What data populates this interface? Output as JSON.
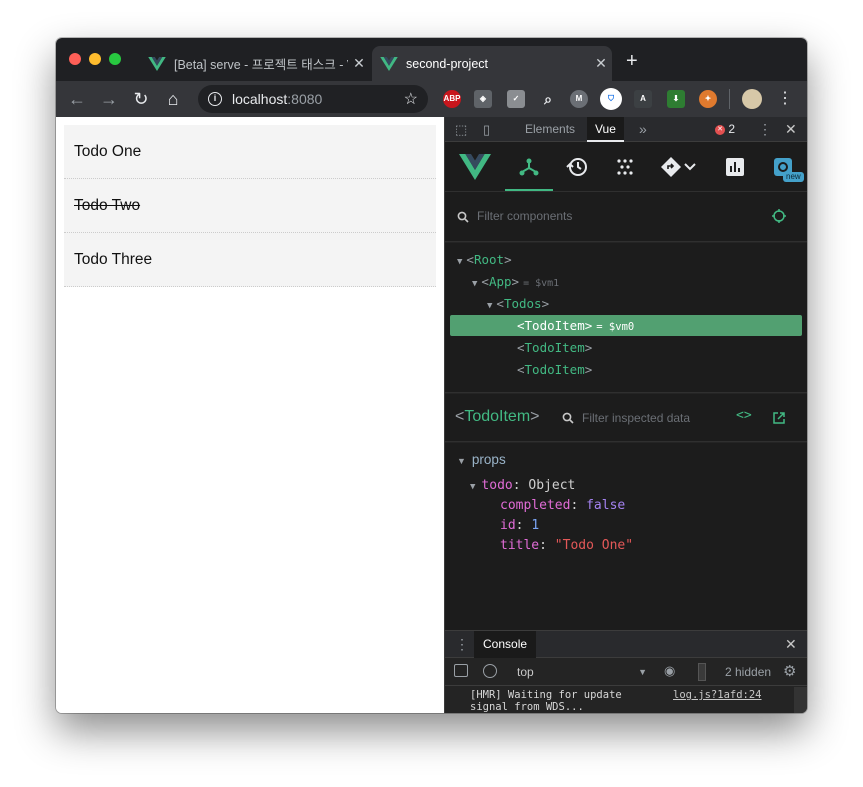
{
  "browser": {
    "tabs": [
      {
        "title": "[Beta] serve - 프로젝트 태스크 - Vu",
        "active": false
      },
      {
        "title": "second-project",
        "active": true
      }
    ],
    "new_tab_label": "+",
    "url_host": "localhost",
    "url_port": ":8080",
    "info_icon": "i"
  },
  "page": {
    "todos": [
      {
        "title": "Todo One",
        "completed": false
      },
      {
        "title": "Todo Two",
        "completed": true
      },
      {
        "title": "Todo Three",
        "completed": false
      }
    ]
  },
  "devtools": {
    "tabs": {
      "elements": "Elements",
      "vue": "Vue",
      "more": "»"
    },
    "error_count": "2",
    "new_badge": "new",
    "filter_components_placeholder": "Filter components",
    "tree": {
      "root": "Root",
      "app": "App",
      "app_vm": "= $vm1",
      "todos": "Todos",
      "items": [
        {
          "name": "TodoItem",
          "vm": "= $vm0",
          "selected": true
        },
        {
          "name": "TodoItem",
          "vm": "",
          "selected": false
        },
        {
          "name": "TodoItem",
          "vm": "",
          "selected": false
        }
      ]
    },
    "inspected": {
      "component": "TodoItem",
      "filter_placeholder": "Filter inspected data",
      "section": "props",
      "todo_key": "todo",
      "todo_type": "Object",
      "fields": [
        {
          "key": "completed",
          "value": "false",
          "kind": "kw"
        },
        {
          "key": "id",
          "value": "1",
          "kind": "num"
        },
        {
          "key": "title",
          "value": "\"Todo One\"",
          "kind": "str"
        }
      ]
    },
    "console": {
      "tab": "Console",
      "context": "top",
      "hidden": "2 hidden",
      "message_line1": "[HMR] Waiting for update",
      "message_line2": "signal from WDS...",
      "source": "log.js?1afd:24",
      "prompt": "›"
    }
  },
  "colors": {
    "vue_green": "#42b983",
    "selected_row": "#52a071",
    "chrome_dark": "#35363a"
  }
}
